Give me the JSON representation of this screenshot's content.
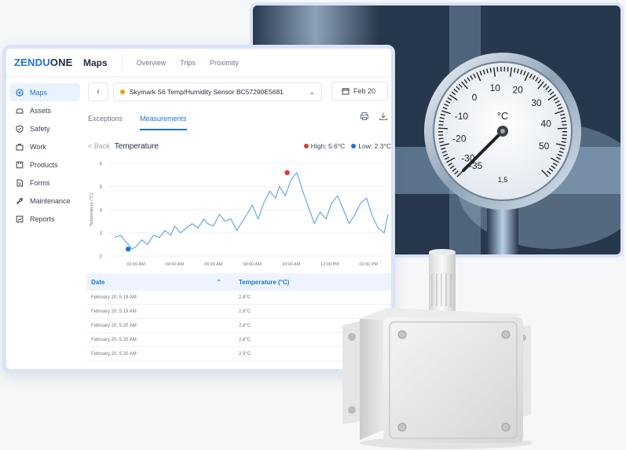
{
  "app": {
    "logo_brand": "ZENDU",
    "logo_suffix": "ONE",
    "section": "Maps",
    "top_tabs": [
      "Overview",
      "Trips",
      "Proximity"
    ]
  },
  "sidebar": {
    "items": [
      {
        "label": "Maps",
        "icon": "map-pin-icon",
        "active": true
      },
      {
        "label": "Assets",
        "icon": "car-icon",
        "active": false
      },
      {
        "label": "Safety",
        "icon": "shield-icon",
        "active": false
      },
      {
        "label": "Work",
        "icon": "briefcase-icon",
        "active": false
      },
      {
        "label": "Products",
        "icon": "box-icon",
        "active": false
      },
      {
        "label": "Forms",
        "icon": "document-icon",
        "active": false
      },
      {
        "label": "Maintenance",
        "icon": "wrench-icon",
        "active": false
      },
      {
        "label": "Reports",
        "icon": "chart-icon",
        "active": false
      }
    ]
  },
  "sensor": {
    "name": "Skymark S6 Temp/Humidity Sensor BC57290E5681",
    "status_color": "#f29c11",
    "date": "Feb 20"
  },
  "subtabs": {
    "exceptions": "Exceptions",
    "measurements": "Measurements"
  },
  "chart_head": {
    "back": "< Back",
    "title": "Temperature",
    "high": "High: 5.6°C",
    "low": "Low: 2.3°C",
    "high_color": "#e53935",
    "low_color": "#1c74d9"
  },
  "chart_data": {
    "type": "line",
    "ylabel": "Temperature (°C)",
    "ylim": [
      2,
      6
    ],
    "yticks": [
      2,
      3,
      4,
      5,
      6
    ],
    "x_tick_labels": [
      "02:00 AM",
      "04:00 AM",
      "06:00 AM",
      "08:00 AM",
      "10:00 AM",
      "12:00 PM",
      "02:00 PM"
    ],
    "x_hours": [
      0.9,
      1.2,
      1.5,
      1.8,
      2.0,
      2.3,
      2.6,
      2.9,
      3.2,
      3.5,
      3.8,
      4.0,
      4.3,
      4.6,
      4.9,
      5.2,
      5.5,
      5.7,
      6.0,
      6.3,
      6.6,
      6.9,
      7.2,
      7.5,
      7.8,
      8.0,
      8.3,
      8.6,
      8.9,
      9.2,
      9.4,
      9.7,
      10.0,
      10.3,
      10.6,
      10.9,
      11.2,
      11.5,
      11.8,
      12.1,
      12.4,
      12.7,
      13.0,
      13.3,
      13.6,
      13.9,
      14.2,
      14.5,
      14.8,
      15.0
    ],
    "values": [
      2.8,
      2.9,
      2.6,
      2.3,
      2.4,
      2.7,
      2.5,
      2.9,
      2.8,
      3.1,
      2.9,
      3.3,
      3.0,
      3.2,
      3.4,
      3.2,
      3.6,
      3.4,
      3.3,
      3.8,
      3.5,
      3.6,
      3.1,
      3.5,
      3.9,
      4.2,
      3.6,
      4.3,
      4.8,
      4.5,
      5.0,
      4.6,
      5.3,
      5.6,
      4.8,
      4.1,
      3.4,
      3.9,
      3.6,
      4.3,
      4.6,
      4.0,
      3.4,
      3.8,
      4.3,
      4.5,
      3.7,
      3.2,
      3.0,
      3.8
    ],
    "high_point": {
      "x": 9.8,
      "y": 5.6
    },
    "low_point": {
      "x": 1.6,
      "y": 2.3
    },
    "xlim": [
      0.5,
      15.0
    ],
    "line_color": "#5aa0e8"
  },
  "table": {
    "headers": [
      "Date",
      "Temperature (°C)"
    ],
    "rows": [
      [
        "February 20, 5:18 AM",
        "2.8°C"
      ],
      [
        "February 20, 5:19 AM",
        "2.8°C"
      ],
      [
        "February 20, 5:20 AM",
        "2.8°C"
      ],
      [
        "February 20, 5:20 AM",
        "2.8°C"
      ],
      [
        "February 20, 5:20 AM",
        "2.9°C"
      ]
    ]
  },
  "gauge": {
    "unit": "°C",
    "labels": [
      "-35",
      "-30",
      "-20",
      "-10",
      "0",
      "10",
      "20",
      "30",
      "40",
      "50"
    ],
    "footer": "1,5"
  }
}
